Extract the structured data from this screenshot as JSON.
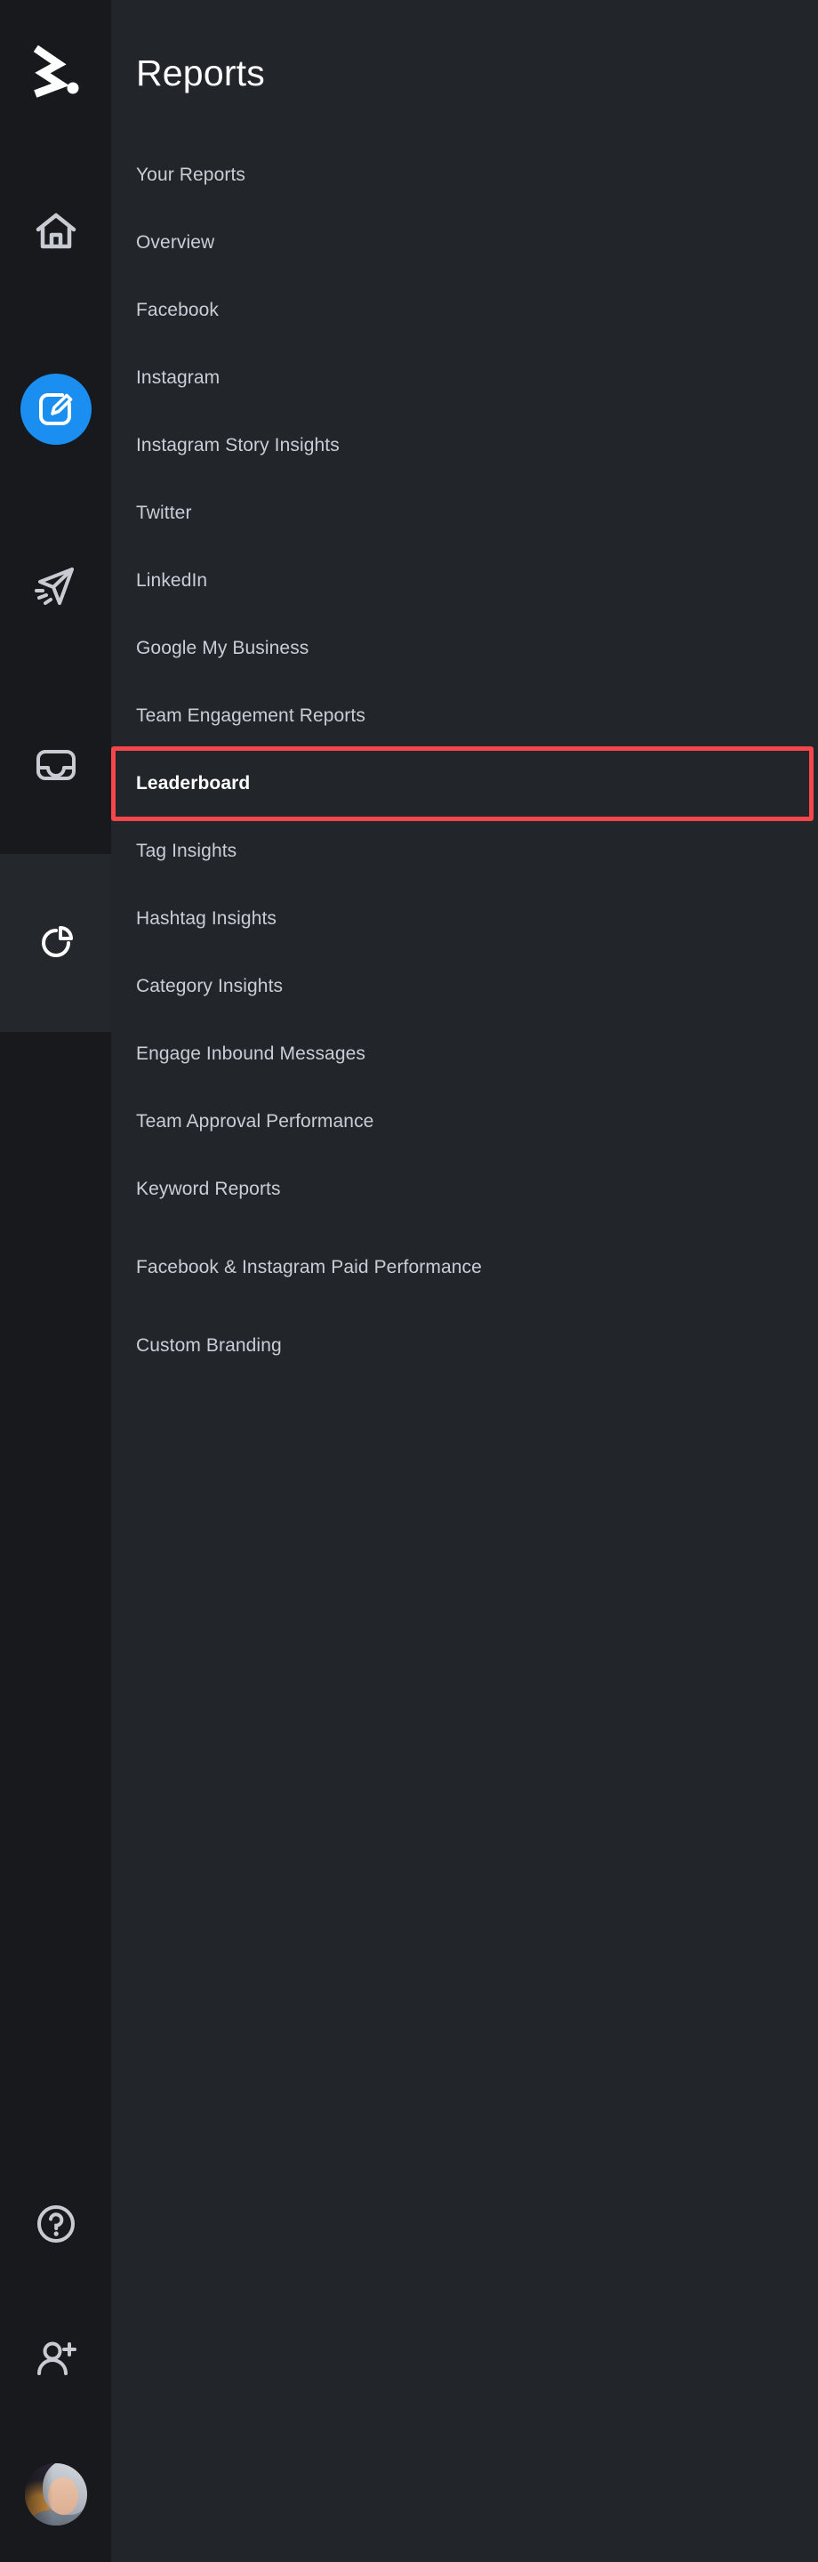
{
  "colors": {
    "rail_bg": "#17191c",
    "panel_bg": "#22262b",
    "accent_blue": "#1b8ef2",
    "highlight_red": "#f4464b",
    "text_muted": "#c9ced6",
    "text_active": "#ffffff"
  },
  "rail": {
    "logo_name": "sprout-social-logo",
    "items": [
      {
        "name": "home-icon",
        "label": "Home",
        "active": false
      },
      {
        "name": "compose-icon",
        "label": "Publishing",
        "active": true,
        "style": "blue-circle"
      },
      {
        "name": "send-icon",
        "label": "Send",
        "active": false
      },
      {
        "name": "inbox-icon",
        "label": "Smart Inbox",
        "active": false
      },
      {
        "name": "pie-chart-icon",
        "label": "Reports",
        "active": false,
        "selected": true
      }
    ],
    "bottom_items": [
      {
        "name": "help-icon",
        "label": "Help"
      },
      {
        "name": "add-user-icon",
        "label": "Invite"
      },
      {
        "name": "avatar",
        "label": "Account"
      }
    ]
  },
  "panel": {
    "title": "Reports",
    "menu": [
      {
        "label": "Your Reports",
        "current": false
      },
      {
        "label": "Overview",
        "current": false
      },
      {
        "label": "Facebook",
        "current": false
      },
      {
        "label": "Instagram",
        "current": false
      },
      {
        "label": "Instagram Story Insights",
        "current": false
      },
      {
        "label": "Twitter",
        "current": false
      },
      {
        "label": "LinkedIn",
        "current": false
      },
      {
        "label": "Google My Business",
        "current": false
      },
      {
        "label": "Team Engagement Reports",
        "current": false
      },
      {
        "label": "Leaderboard",
        "current": true
      },
      {
        "label": "Tag Insights",
        "current": false
      },
      {
        "label": "Hashtag Insights",
        "current": false
      },
      {
        "label": "Category Insights",
        "current": false
      },
      {
        "label": "Engage Inbound Messages",
        "current": false
      },
      {
        "label": "Team Approval Performance",
        "current": false
      },
      {
        "label": "Keyword Reports",
        "current": false
      },
      {
        "label": "Facebook & Instagram Paid Performance",
        "current": false,
        "two_line": true
      },
      {
        "label": "Custom Branding",
        "current": false
      }
    ]
  },
  "annotation": {
    "name": "leaderboard-highlight-box",
    "target_label": "Leaderboard",
    "color": "#f4464b"
  }
}
